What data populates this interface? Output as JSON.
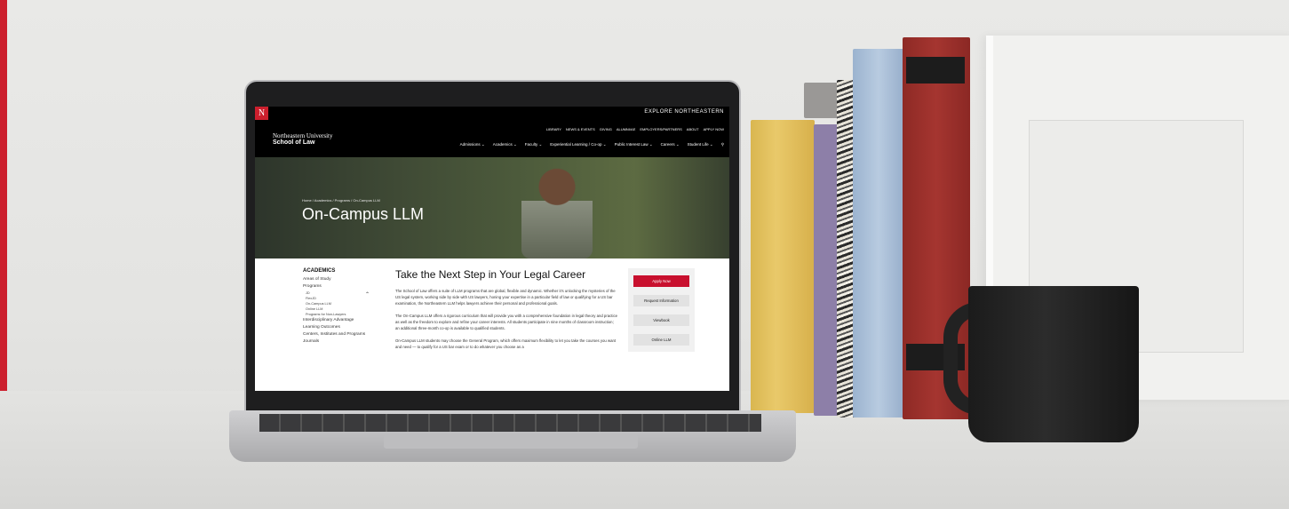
{
  "site": {
    "topbar": {
      "explore": "EXPLORE NORTHEASTERN"
    },
    "logo": {
      "line1": "Northeastern University",
      "line2": "School of Law"
    },
    "utility_nav": [
      "LIBRARY",
      "NEWS & EVENTS",
      "GIVING",
      "ALUMNI/AE",
      "EMPLOYERS/PARTNERS",
      "ABOUT",
      "APPLY NOW"
    ],
    "main_nav": [
      "Admissions ⌄",
      "Academics ⌄",
      "Faculty ⌄",
      "Experiential Learning / Co-op ⌄",
      "Public Interest Law ⌄",
      "Careers ⌄",
      "Student Life ⌄"
    ],
    "hero": {
      "breadcrumb": "Home / Academics / Programs / On-Campus LLM",
      "title": "On-Campus LLM"
    },
    "sidebar": {
      "heading": "ACADEMICS",
      "items": [
        {
          "label": "Areas of Study"
        },
        {
          "label": "Programs",
          "expanded": true,
          "children": [
            "JD",
            "FlexJD",
            "On-Campus LLM",
            "Online LLM",
            "Programs for Non-Lawyers"
          ]
        },
        {
          "label": "Interdisciplinary Advantage"
        },
        {
          "label": "Learning Outcomes"
        },
        {
          "label": "Centers, Institutes and Programs"
        },
        {
          "label": "Journals"
        }
      ]
    },
    "main": {
      "title": "Take the Next Step in Your Legal Career",
      "p1": "The School of Law offers a suite of LLM programs that are global, flexible and dynamic. Whether it's unlocking the mysteries of the US legal system, working side by side with US lawyers, honing your expertise in a particular field of law or qualifying for a US bar examination, the Northeastern LLM helps lawyers achieve their personal and professional goals.",
      "p2": "The On-Campus LLM offers a rigorous curriculum that will provide you with a comprehensive foundation in legal theory and practice as well as the freedom to explore and refine your career interests. All students participate in nine months of classroom instruction; an additional three-month co-op is available to qualified students.",
      "p3": "On-Campus LLM students may choose the General Program, which offers maximum flexibility to let you take the courses you want and need — to qualify for a US bar exam or to do whatever you choose as a"
    },
    "cta": [
      "Apply Now",
      "Request Information",
      "Viewbook",
      "Online LLM"
    ]
  },
  "colors": {
    "accent": "#cc1f2d",
    "header": "#000000",
    "button_primary": "#c8102e"
  }
}
